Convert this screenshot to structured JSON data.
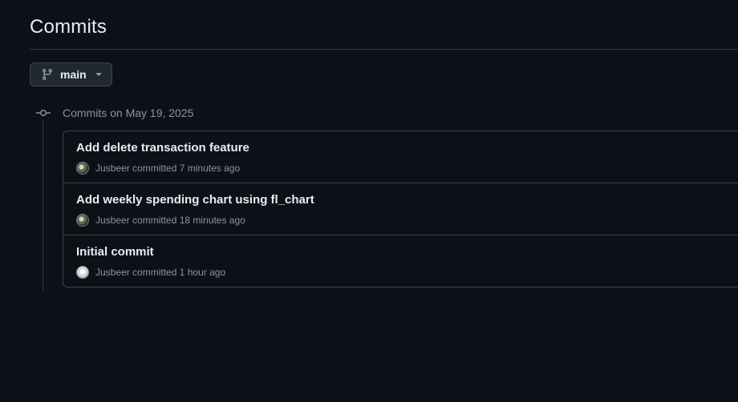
{
  "page": {
    "title": "Commits"
  },
  "branch": {
    "icon": "git-branch-icon",
    "label": "main",
    "caret_icon": "triangle-down-icon"
  },
  "commit_group": {
    "icon": "git-commit-icon",
    "heading": "Commits on May 19, 2025",
    "commits": [
      {
        "message": "Add delete transaction feature",
        "author": "Jusbeer",
        "action": "committed",
        "time": "7 minutes ago",
        "avatar_style": "dark"
      },
      {
        "message": "Add weekly spending chart using fl_chart",
        "author": "Jusbeer",
        "action": "committed",
        "time": "18 minutes ago",
        "avatar_style": "dark"
      },
      {
        "message": "Initial commit",
        "author": "Jusbeer",
        "action": "committed",
        "time": "1 hour ago",
        "avatar_style": "light"
      }
    ]
  },
  "colors": {
    "background": "#0d1117",
    "text_primary": "#e6edf3",
    "text_muted": "#8b949e",
    "border": "#3d444d"
  }
}
